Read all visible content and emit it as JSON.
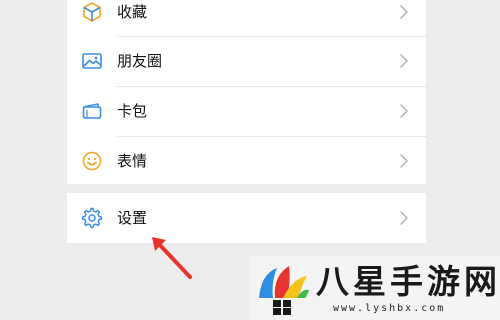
{
  "menu": {
    "items": [
      {
        "label": "收藏",
        "icon": "favorites-cube-icon"
      },
      {
        "label": "朋友圈",
        "icon": "moments-picture-icon"
      },
      {
        "label": "卡包",
        "icon": "card-wallet-icon"
      },
      {
        "label": "表情",
        "icon": "sticker-smile-icon"
      }
    ],
    "settings": {
      "label": "设置",
      "icon": "gear-icon"
    }
  },
  "annotation": {
    "arrow_color": "#e8342f"
  },
  "watermark": {
    "text": "八星手游网",
    "url": "www.lyshbx.com"
  },
  "colors": {
    "background": "#ededed",
    "card": "#ffffff",
    "icon_blue": "#3a8ee6",
    "icon_orange": "#f5a623",
    "chevron": "#b2b2b2"
  }
}
